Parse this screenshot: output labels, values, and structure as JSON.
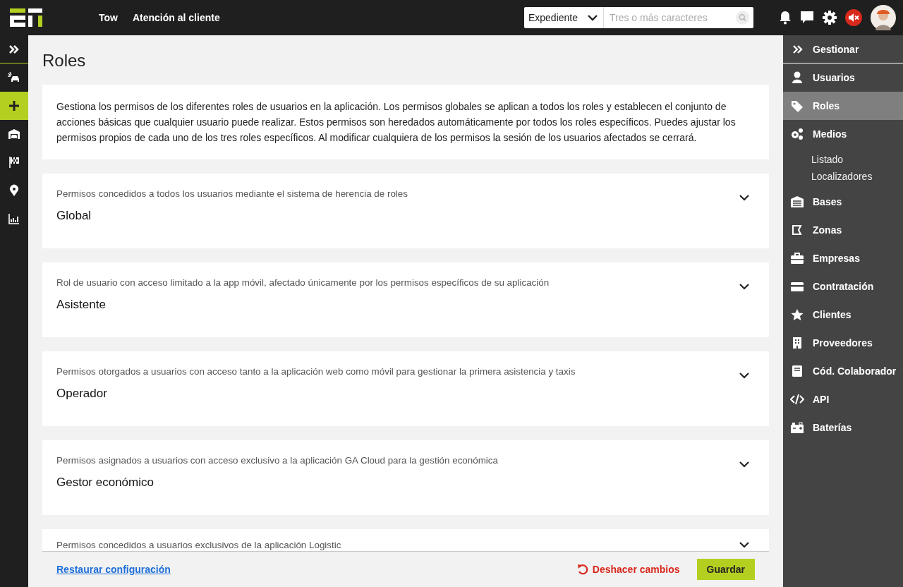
{
  "topbar": {
    "nav": [
      "Tow",
      "Atención al cliente"
    ],
    "search": {
      "scope": "Expediente",
      "placeholder": "Tres o más caracteres"
    },
    "muted": true
  },
  "left_nav": [
    {
      "selected": false
    },
    {
      "selected": false
    },
    {
      "selected": true
    },
    {
      "selected": false
    },
    {
      "selected": false
    },
    {
      "selected": false
    },
    {
      "selected": false
    }
  ],
  "page": {
    "title": "Roles",
    "intro": "Gestiona los permisos de los diferentes roles de usuarios en la aplicación. Los permisos globales se aplican a todos los roles y establecen el conjunto de acciones básicas que cualquier usuario puede realizar. Estos permisos son heredados automáticamente por todos los roles específicos. Puedes ajustar los permisos propios de cada uno de los tres roles específicos. Al modificar cualquiera de los permisos la sesión de los usuarios afectados se cerrará.",
    "roles": [
      {
        "description": "Permisos concedidos a todos los usuarios mediante el sistema de herencia de roles",
        "name": "Global",
        "expanded": false
      },
      {
        "description": "Rol de usuario con acceso limitado a la app móvil, afectado únicamente por los permisos específicos de su aplicación",
        "name": "Asistente",
        "expanded": false
      },
      {
        "description": "Permisos otorgados a usuarios con acceso tanto a la aplicación web como móvil para gestionar la primera asistencia y taxis",
        "name": "Operador",
        "expanded": false
      },
      {
        "description": "Permisos asignados a usuarios con acceso exclusivo a la aplicación GA Cloud para la gestión económica",
        "name": "Gestor económico",
        "expanded": false
      },
      {
        "description": "Permisos concedidos a usuarios exclusivos de la aplicación Logistic",
        "expanded": false
      }
    ]
  },
  "footer": {
    "reset_link": "Restaurar configuración",
    "undo": "Deshacer cambios",
    "save": "Guardar"
  },
  "right_nav": {
    "header": "Gestionar",
    "items": [
      {
        "label": "Usuarios",
        "selected": false
      },
      {
        "label": "Roles",
        "selected": true
      },
      {
        "label": "Medios",
        "selected": false,
        "children": [
          {
            "label": "Listado",
            "selected": false
          },
          {
            "label": "Localizadores",
            "selected": false
          }
        ]
      },
      {
        "label": "Bases",
        "selected": false
      },
      {
        "label": "Zonas",
        "selected": false
      },
      {
        "label": "Empresas",
        "selected": false
      },
      {
        "label": "Contratación",
        "selected": false
      },
      {
        "label": "Clientes",
        "selected": false
      },
      {
        "label": "Proveedores",
        "selected": false
      },
      {
        "label": "Cód. Colaborador",
        "selected": false
      },
      {
        "label": "API",
        "selected": false
      },
      {
        "label": "Baterías",
        "selected": false
      }
    ]
  }
}
